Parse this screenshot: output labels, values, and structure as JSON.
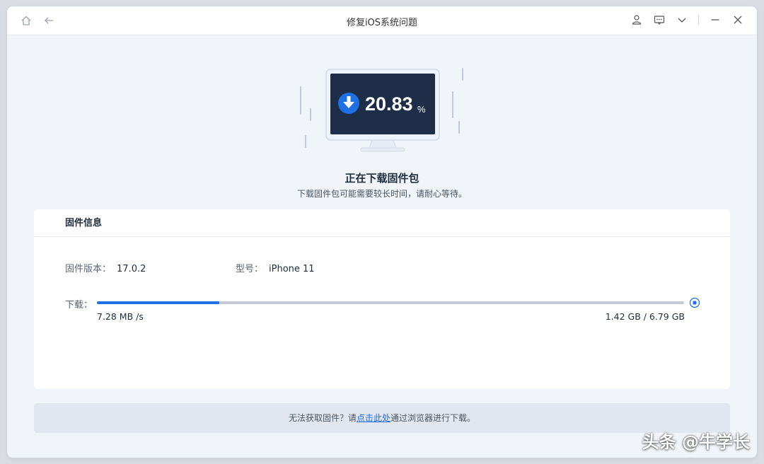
{
  "window": {
    "title": "修复iOS系统问题"
  },
  "titlebar": {
    "icons": [
      "home-icon",
      "back-arrow-icon",
      "user-icon",
      "feedback-icon",
      "chevron-down-icon",
      "minimize-icon",
      "close-icon"
    ]
  },
  "hero": {
    "progress_value": "20.83",
    "progress_unit": "%",
    "status_title": "正在下载固件包",
    "status_sub": "下载固件包可能需要较长时间，请耐心等待。"
  },
  "firmware": {
    "section_title": "固件信息",
    "version_label": "固件版本：",
    "version_value": "17.0.2",
    "model_label": "型号：",
    "model_value": "iPhone 11",
    "download_label": "下载：",
    "download_progress": 0.2083,
    "speed": "7.28 MB /s",
    "size": "1.42 GB / 6.79 GB"
  },
  "footer": {
    "prefix": "无法获取固件？请",
    "link": "点击此处",
    "suffix": "通过浏览器进行下载。"
  },
  "watermark": {
    "text": "头条 @牛学长"
  },
  "colors": {
    "accent": "#1f6fe5",
    "monitor_screen": "#1e2d48",
    "window_bg": "#f1f4f9"
  }
}
